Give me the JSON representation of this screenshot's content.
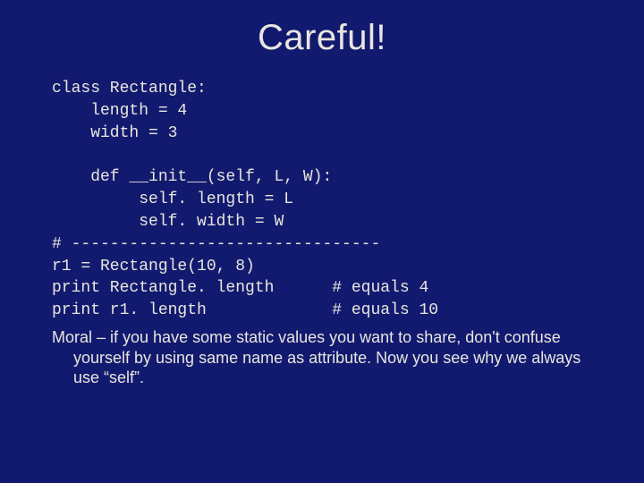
{
  "title": "Careful!",
  "code": {
    "l1": "class Rectangle:",
    "l2": "    length = 4",
    "l3": "    width = 3",
    "l4": "",
    "l5": "    def __init__(self, L, W):",
    "l6": "         self. length = L",
    "l7": "         self. width = W",
    "l8": "# --------------------------------",
    "l9": "r1 = Rectangle(10, 8)",
    "l10": "print Rectangle. length      # equals 4",
    "l11": "print r1. length             # equals 10"
  },
  "moral": "Moral – if you have some static values you want to share, don't confuse yourself by using same name as attribute.  Now you see why we always use “self”."
}
